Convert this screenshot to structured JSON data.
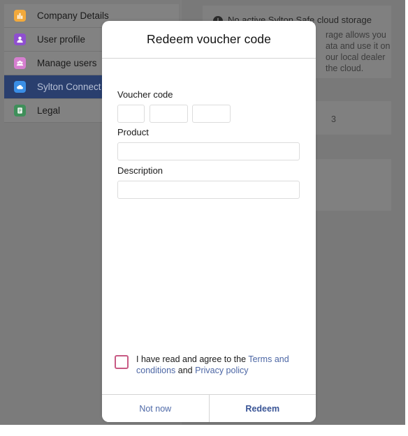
{
  "colors": {
    "accent": "#3a5596",
    "link": "#4d67a5",
    "checkbox_border": "#c85a84",
    "active_nav": "#2a3f6e"
  },
  "sidebar": {
    "items": [
      {
        "label": "Company Details",
        "icon": "building-icon",
        "icon_color": "#f2a93b"
      },
      {
        "label": "User profile",
        "icon": "user-icon",
        "icon_color": "#8f4fcf"
      },
      {
        "label": "Manage users",
        "icon": "users-icon",
        "icon_color": "#d67fd0"
      },
      {
        "label": "Sylton Connect",
        "icon": "cloud-icon",
        "icon_color": "#3a8ee6",
        "active": true
      },
      {
        "label": "Legal",
        "icon": "document-icon",
        "icon_color": "#3f8f5a"
      }
    ]
  },
  "background": {
    "storage_title": "No active Sylton Safe cloud storage",
    "storage_lines": [
      "rage allows you",
      "ata and use it on",
      "our local dealer",
      "the cloud."
    ],
    "partial_glyph": "3"
  },
  "modal": {
    "title": "Redeem voucher code",
    "voucher_label": "Voucher code",
    "voucher_segments": [
      "",
      "",
      ""
    ],
    "product_label": "Product",
    "product_value": "",
    "description_label": "Description",
    "description_value": "",
    "agree_prefix": "I have read and agree to the ",
    "terms_link": "Terms and conditions",
    "agree_and": " and ",
    "privacy_link": "Privacy policy",
    "not_now_label": "Not now",
    "redeem_label": "Redeem"
  }
}
